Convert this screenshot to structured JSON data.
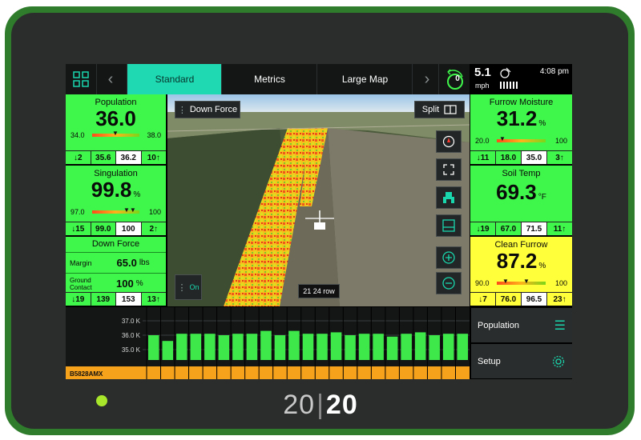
{
  "nav": {
    "tabs": [
      {
        "label": "Standard",
        "active": true
      },
      {
        "label": "Metrics",
        "active": false
      },
      {
        "label": "Large Map",
        "active": false
      }
    ],
    "alert_count": "0"
  },
  "status": {
    "speed": "5.1",
    "speed_unit": "mph",
    "time": "4:08 pm"
  },
  "left_panels": {
    "population": {
      "title": "Population",
      "value": "36.0",
      "min": "34.0",
      "max": "38.0",
      "low_count": "2",
      "low": "35.6",
      "mid": "36.2",
      "high": "10",
      "up_count": "10"
    },
    "singulation": {
      "title": "Singulation",
      "value": "99.8",
      "unit": "%",
      "min": "97.0",
      "max": "100",
      "low_count": "15",
      "low": "99.0",
      "mid": "100",
      "up_count": "2"
    },
    "down_force": {
      "title": "Down Force",
      "margin_label": "Margin",
      "margin_value": "65.0",
      "margin_unit": "lbs",
      "gc_label_1": "Ground",
      "gc_label_2": "Contact",
      "gc_value": "100",
      "gc_unit": "%",
      "low_count": "19",
      "low": "139",
      "mid": "153",
      "up_count": "13"
    }
  },
  "right_panels": {
    "furrow_moisture": {
      "title": "Furrow Moisture",
      "value": "31.2",
      "unit": "%",
      "min": "20.0",
      "max": "100",
      "low_count": "11",
      "low": "18.0",
      "mid": "35.0",
      "up_count": "3"
    },
    "soil_temp": {
      "title": "Soil Temp",
      "value": "69.3",
      "unit": "°F",
      "low_count": "19",
      "low": "67.0",
      "mid": "71.5",
      "up_count": "11"
    },
    "clean_furrow": {
      "title": "Clean Furrow",
      "value": "87.2",
      "unit": "%",
      "min": "90.0",
      "max": "100",
      "low_count": "7",
      "low": "76.0",
      "mid": "96.5",
      "up_count": "23"
    }
  },
  "map": {
    "overlay_label": "Down Force",
    "split_label": "Split",
    "toggle_label": "On",
    "row_label": "21 24 row"
  },
  "row_chart": {
    "y_labels": [
      "37.0 K",
      "36.0 K",
      "35.0 K"
    ],
    "row_values": [
      36.0,
      35.6,
      36.1,
      36.1,
      36.1,
      36.0,
      36.1,
      36.1,
      36.3,
      36.0,
      36.3,
      36.1,
      36.1,
      36.2,
      36.0,
      36.1,
      36.1,
      35.9,
      36.1,
      36.2,
      36.0,
      36.1,
      36.1
    ],
    "seed_label": "B5828AMX",
    "colors": {
      "bar": "#3ee84a",
      "seed_strip": "#f7a21b"
    }
  },
  "side_menu": {
    "population_label": "Population",
    "setup_label": "Setup"
  },
  "brand": {
    "left": "20",
    "right": "20"
  },
  "colors": {
    "panel_green": "#3ff64a",
    "panel_yellow": "#ffff3a",
    "tab_active": "#1fd9b3",
    "bezel_green": "#2f7d2c"
  }
}
